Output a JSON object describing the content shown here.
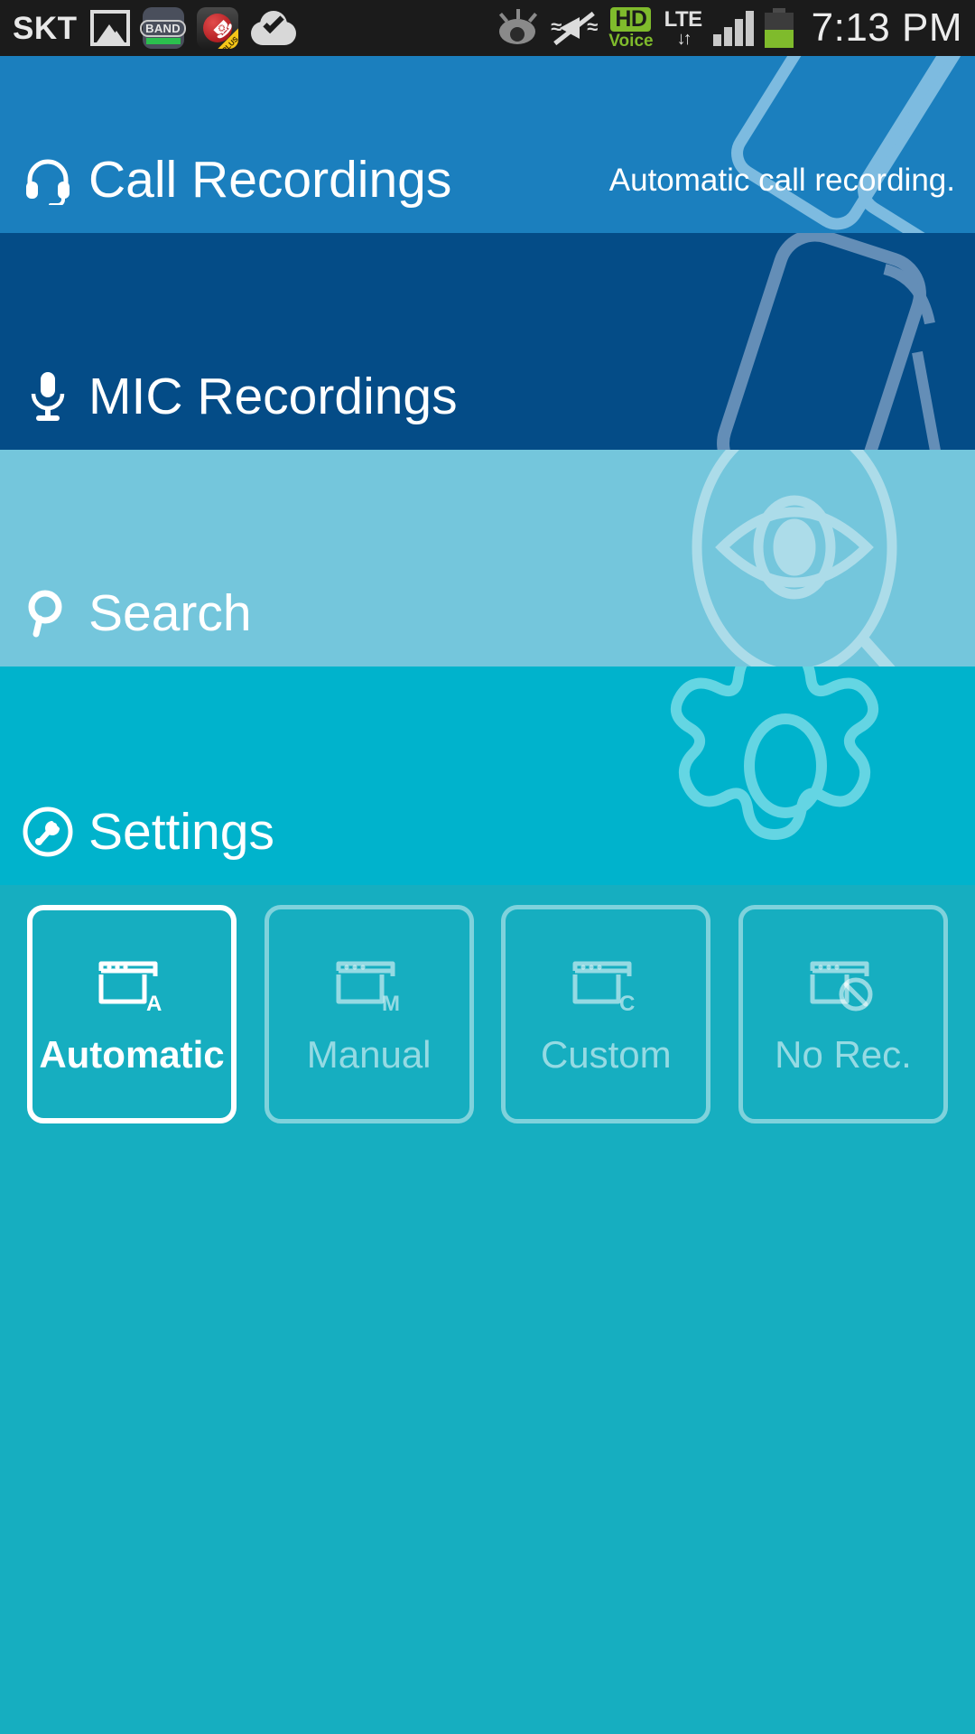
{
  "status_bar": {
    "carrier": "SKT",
    "time": "7:13 PM",
    "left_icons": [
      {
        "name": "screenshot-icon",
        "label": "Screenshot"
      },
      {
        "name": "band-app-icon",
        "label": "BAND"
      },
      {
        "name": "call-recorder-icon",
        "label": "PLUS"
      },
      {
        "name": "cloud-sync-icon",
        "label": "Cloud sync"
      }
    ],
    "right_icons": [
      {
        "name": "smart-stay-eye-icon",
        "label": "Smart stay"
      },
      {
        "name": "sound-muted-vibrate-icon",
        "label": "Muted"
      },
      {
        "name": "hd-voice-icon",
        "label": "HD",
        "sub_label": "Voice"
      },
      {
        "name": "lte-data-icon",
        "label": "LTE",
        "arrows": "↓↑"
      },
      {
        "name": "signal-bars-icon",
        "label": "Signal 4 bars"
      },
      {
        "name": "battery-icon",
        "label": "Battery"
      }
    ],
    "colors": {
      "background": "#1b1b1b",
      "hd_green": "#7fbb2c",
      "battery_green": "#7fbb2c"
    }
  },
  "sections": [
    {
      "id": "call-recordings",
      "label": "Call Recordings",
      "subtitle": "Automatic call recording.",
      "icon": "headset-icon",
      "background": "#1b7fbe",
      "art": "tilted-phone-outline"
    },
    {
      "id": "mic-recordings",
      "label": "MIC Recordings",
      "subtitle": "",
      "icon": "microphone-icon",
      "background": "#044c87",
      "art": "rounded-phone-outline"
    },
    {
      "id": "search",
      "label": "Search",
      "subtitle": "",
      "icon": "magnifier-icon",
      "background": "#74c6dc",
      "art": "eye-in-magnifier-outline"
    },
    {
      "id": "settings",
      "label": "Settings",
      "subtitle": "",
      "icon": "wrench-circle-icon",
      "background": "#00b3cc",
      "art": "gear-outline"
    }
  ],
  "modes": {
    "background": "#16aec0",
    "selected_index": 0,
    "items": [
      {
        "id": "automatic",
        "label": "Automatic",
        "icon": "window-a-icon",
        "selected": true
      },
      {
        "id": "manual",
        "label": "Manual",
        "icon": "window-m-icon",
        "selected": false
      },
      {
        "id": "custom",
        "label": "Custom",
        "icon": "window-c-icon",
        "selected": false
      },
      {
        "id": "no-rec",
        "label": "No Rec.",
        "icon": "window-blocked-icon",
        "selected": false
      }
    ]
  }
}
